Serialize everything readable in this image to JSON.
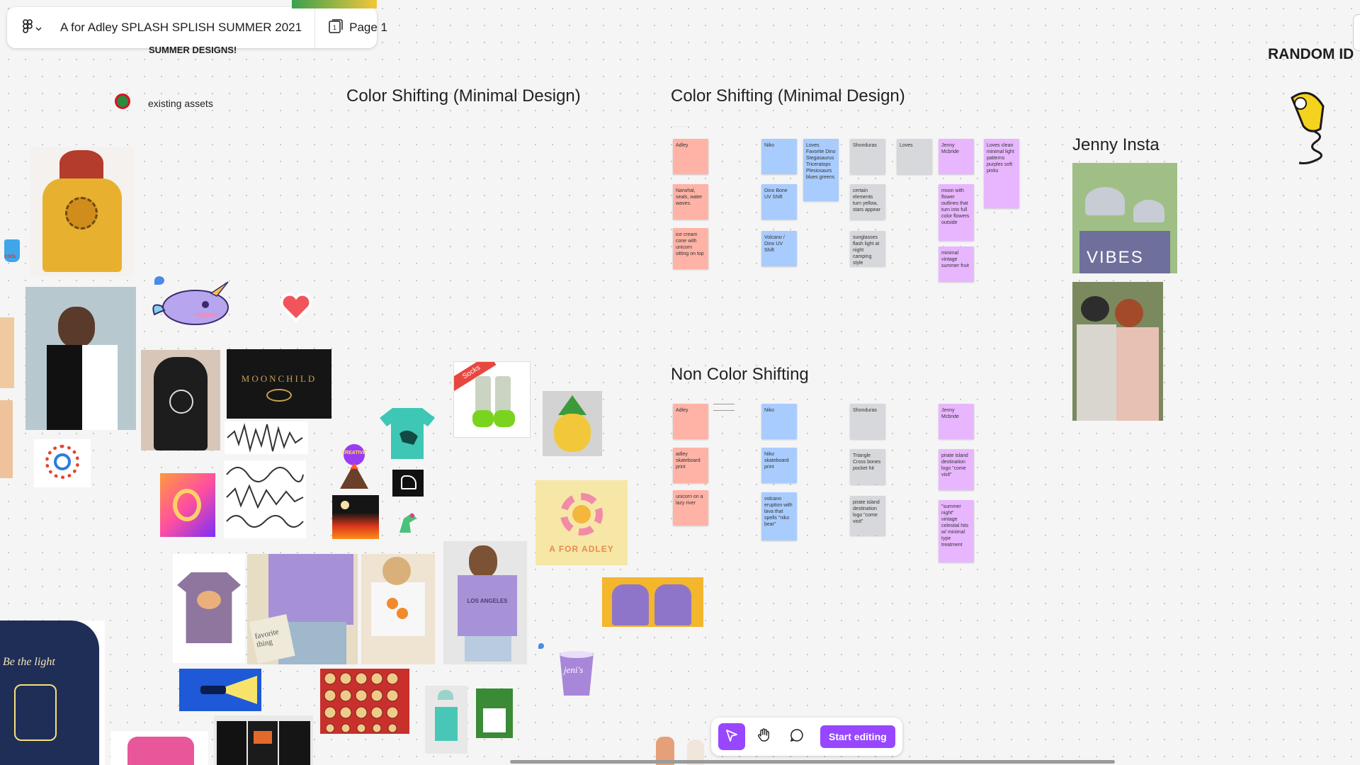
{
  "filebar": {
    "file_name": "A for Adley SPLASH SPLISH SUMMER 2021",
    "page_label": "Page 1"
  },
  "labels": {
    "summer_designs": "SUMMER DESIGNS!",
    "existing_assets": "existing assets",
    "random_ideas": "RANDOM ID",
    "jenny_insta": "Jenny Insta",
    "color_shifting_1": "Color Shifting (Minimal Design)",
    "color_shifting_2": "Color Shifting (Minimal Design)",
    "non_color_shifting": "Non Color Shifting"
  },
  "color_shifting_stickies": {
    "adley": [
      "Adley",
      "Narwhal, seals, water waves.",
      "ice cream cone with unicorn sitting on top"
    ],
    "niko": [
      "Niko",
      "Dino Bone UV Shift",
      "Volcano / Dino UV Shift"
    ],
    "niko_loves": "Loves Favorite Dino Stegasaurus Triceratops Plesiosaurs blues greens",
    "shonduras": [
      "Shonduras",
      "certain elements turn yellow, stars appear",
      "sunglasses flash light at night camping style"
    ],
    "shonduras_loves": "Loves",
    "jenny": [
      "Jenny Mcbride",
      "moon with flower outlines that turn into full color flowers outside",
      "minimal vintage summer fruit"
    ],
    "jenny_loves": "Loves clean minimal light patterns purples soft pinks"
  },
  "non_color_shifting_stickies": {
    "adley": [
      "Adley",
      "adley skateboard print",
      "unicorn on a lazy river"
    ],
    "niko": [
      "Niko",
      "Niko skateboard print",
      "volcano eruption with lava that spells \"niko bear\""
    ],
    "shonduras": [
      "Shonduras",
      "Triangle Cross bones pocket hit",
      "pirate island destination logo \"come visit\""
    ],
    "jenny": [
      "Jenny Mcbride",
      "pirate island destination logo \"come visit\"",
      "\"summer night\" vintage celestial hits w/ minimal type treatment"
    ]
  },
  "image_text": {
    "moonchild": "MOONCHILD",
    "socks": "Socks",
    "a_for_adley": "A FOR ADLEY",
    "vibes": "VIBES",
    "cool": "COOL",
    "favorite_thing": "favorite thing",
    "los_angeles": "LOS ANGELES",
    "lead_the_light": "Be the light",
    "jeni": "jeni's",
    "creative": "CREATIVE"
  },
  "toolbar": {
    "start_editing": "Start editing"
  },
  "colors": {
    "accent": "#9747ff",
    "sticky_red": "#ffb3a6",
    "sticky_blue": "#a9ccff",
    "sticky_gray": "#d6d8db",
    "sticky_purple": "#e8b6ff"
  }
}
